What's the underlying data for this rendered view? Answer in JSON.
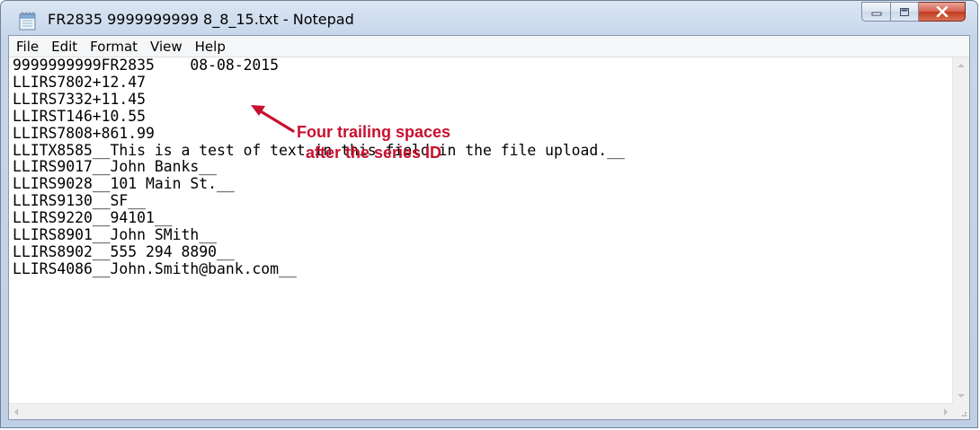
{
  "window": {
    "title": "FR2835 9999999999 8_8_15.txt - Notepad",
    "close_color": "#c23a20"
  },
  "menu": {
    "items": [
      {
        "label": "File"
      },
      {
        "label": "Edit"
      },
      {
        "label": "Format"
      },
      {
        "label": "View"
      },
      {
        "label": "Help"
      }
    ]
  },
  "document": {
    "text": "9999999999FR2835    08-08-2015\nLLIRS7802+12.47\nLLIRS7332+11.45\nLLIRST146+10.55\nLLIRS7808+861.99\nLLITX8585__This is a test of text in this field in the file upload.__\nLLIRS9017__John Banks__\nLLIRS9028__101 Main St.__\nLLIRS9130__SF__\nLLIRS9220__94101__\nLLIRS8901__John SMith__\nLLIRS8902__555 294 8890__\nLLIRS4086__John.Smith@bank.com__"
  },
  "annotation": {
    "line1": "Four trailing spaces",
    "line2": "after the series ID",
    "color": "#c8102e"
  }
}
